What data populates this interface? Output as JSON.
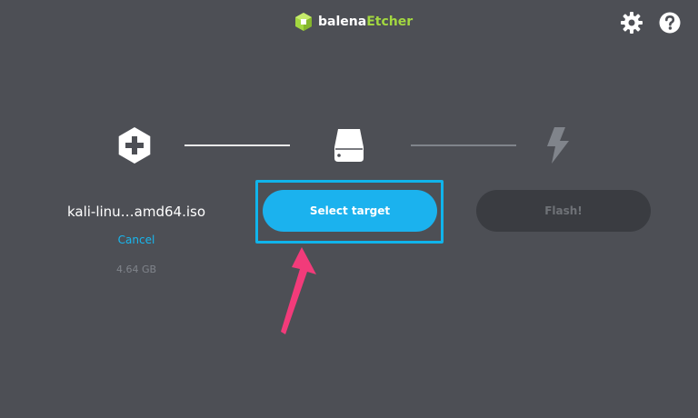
{
  "app": {
    "logo_balena": "balena",
    "logo_etcher": "Etcher"
  },
  "header": {
    "settings_icon": "gear-icon",
    "help_icon": "question-icon"
  },
  "steps": {
    "source": {
      "icon": "plus-hexagon-icon",
      "filename": "kali-linu…amd64.iso",
      "cancel_label": "Cancel",
      "size": "4.64 GB"
    },
    "target": {
      "icon": "drive-icon",
      "button_label": "Select target"
    },
    "flash": {
      "icon": "lightning-icon",
      "button_label": "Flash!"
    }
  },
  "colors": {
    "background": "#4d4f55",
    "accent": "#1bb2ee",
    "etcher_green": "#a3d840",
    "annotation_arrow": "#f23b7a"
  }
}
